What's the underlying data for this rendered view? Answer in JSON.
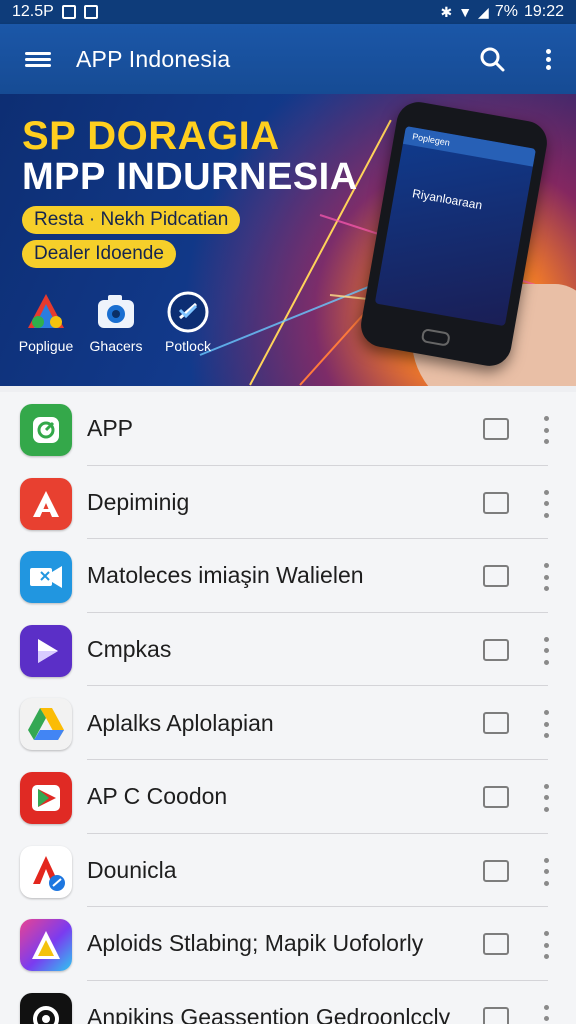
{
  "status_bar": {
    "time_left": "12.5P",
    "battery": "7%",
    "clock": "19:22"
  },
  "app_bar": {
    "title": "APP Indonesia",
    "icons": [
      "menu-icon",
      "search-icon",
      "more-vert-icon"
    ]
  },
  "banner": {
    "headline1": "SP DORAGIA",
    "headline2": "MPP INDURNESIA",
    "pill1": "Resta · Nekh Pidcatian",
    "pill2": "Dealer Idoende",
    "icons": [
      {
        "label": "Popligue",
        "icon": "app-shapes-icon"
      },
      {
        "label": "Ghacers",
        "icon": "camera-icon"
      },
      {
        "label": "Potlock",
        "icon": "lock-badge-icon"
      }
    ],
    "phone_header": "Poplegen",
    "phone_text": "Riyanloaraan"
  },
  "apps": [
    {
      "label": "APP",
      "color": "#34a84a",
      "glyph": "◎",
      "icon": "green-app-icon"
    },
    {
      "label": "Depiminig",
      "color": "#e84030",
      "glyph": "A",
      "icon": "red-a-icon"
    },
    {
      "label": "Matoleces imiaşin Walielen",
      "color": "#2196e0",
      "glyph": "✉",
      "icon": "blue-mail-icon"
    },
    {
      "label": "Cmpkas",
      "color": "#5b2fc7",
      "glyph": "▶",
      "icon": "purple-play-icon"
    },
    {
      "label": "Aplalks Aplolapian",
      "color": "#f2f2f2",
      "glyph": "▲",
      "icon": "drive-icon"
    },
    {
      "label": "AP C Coodon",
      "color": "#e02a24",
      "glyph": "▶",
      "icon": "red-play-icon"
    },
    {
      "label": "Dounicla",
      "color": "#ffffff",
      "glyph": "A",
      "icon": "acrobat-icon"
    },
    {
      "label": "Aploids Stlabing; Mapik Uofolorly",
      "color": "#8a3de0",
      "glyph": "A",
      "icon": "gradient-a-icon"
    },
    {
      "label": "Anpikins Geassention Gedroonlccly",
      "color": "#111111",
      "glyph": "◑",
      "icon": "black-app-icon"
    }
  ]
}
